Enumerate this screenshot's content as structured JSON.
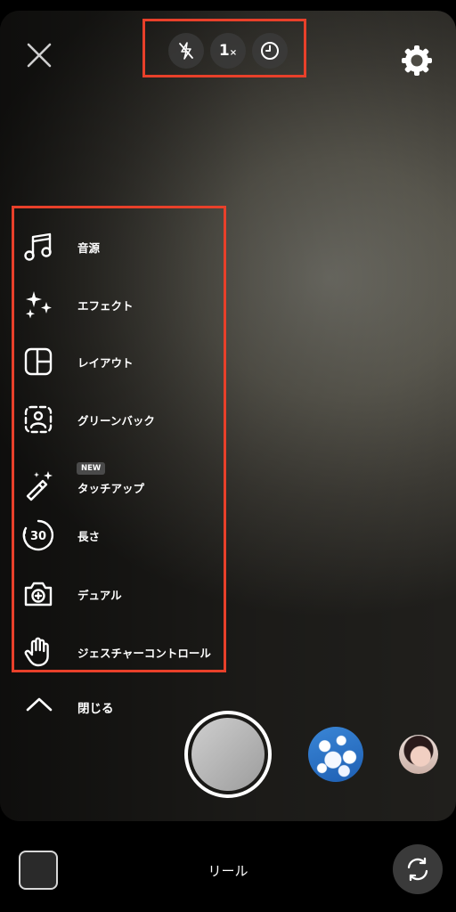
{
  "top_controls": {
    "flash": "flash-off",
    "zoom": "1",
    "zoom_unit": "×",
    "timer": "timer"
  },
  "menu": {
    "items": [
      {
        "label": "音源",
        "icon": "music-icon"
      },
      {
        "label": "エフェクト",
        "icon": "sparkles-icon"
      },
      {
        "label": "レイアウト",
        "icon": "layout-icon"
      },
      {
        "label": "グリーンバック",
        "icon": "green-screen-icon"
      },
      {
        "label": "タッチアップ",
        "icon": "magic-wand-icon",
        "badge": "NEW"
      },
      {
        "label": "長さ",
        "icon": "duration-icon",
        "icon_text": "30"
      },
      {
        "label": "デュアル",
        "icon": "dual-camera-icon"
      },
      {
        "label": "ジェスチャーコントロール",
        "icon": "hand-icon"
      }
    ],
    "collapse_label": "閉じる"
  },
  "bottom": {
    "mode_label": "リール"
  },
  "colors": {
    "highlight": "#e8402a",
    "background": "#000000"
  }
}
